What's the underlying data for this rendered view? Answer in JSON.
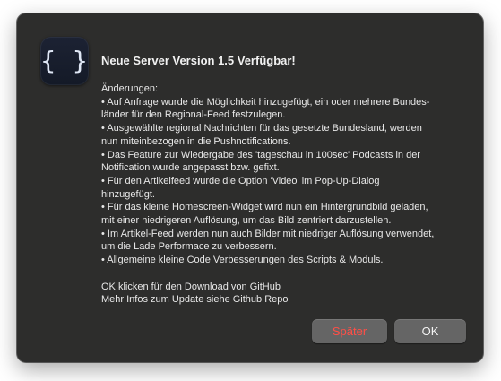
{
  "dialog": {
    "app_icon_glyph": "{ }",
    "app_icon_name": "braces-icon",
    "title": "Neue Server Version 1.5 Verfügbar!",
    "message_lines": [
      "Änderungen:",
      "• Auf Anfrage wurde die Möglichkeit hinzugefügt, ein oder mehrere Bundes-",
      "länder für den Regional-Feed festzulegen.",
      "• Ausgewählte regional Nachrichten für das gesetzte Bundesland, werden",
      "nun miteinbezogen in die Pushnotifications.",
      "• Das Feature zur Wiedergabe des 'tageschau in 100sec' Podcasts in der",
      "Notification wurde angepasst bzw. gefixt.",
      "• Für den Artikelfeed wurde die Option 'Video' im Pop-Up-Dialog",
      "hinzugefügt.",
      "• Für das kleine Homescreen-Widget wird nun ein Hintergrundbild geladen,",
      "mit einer niedrigeren Auflösung, um das Bild zentriert darzustellen.",
      "• Im Artikel-Feed werden nun auch Bilder mit niedriger Auflösung verwendet,",
      "um die Lade Performace zu verbessern.",
      "• Allgemeine kleine Code Verbesserungen des Scripts & Moduls.",
      "",
      "OK klicken für den Download von GitHub",
      "Mehr Infos zum Update siehe Github Repo"
    ],
    "buttons": {
      "cancel_label": "Später",
      "ok_label": "OK"
    }
  },
  "colors": {
    "dialog_background": "#2d2d2c",
    "button_background": "#656565",
    "cancel_text": "#ff4f47",
    "text": "#e8e8e8"
  }
}
